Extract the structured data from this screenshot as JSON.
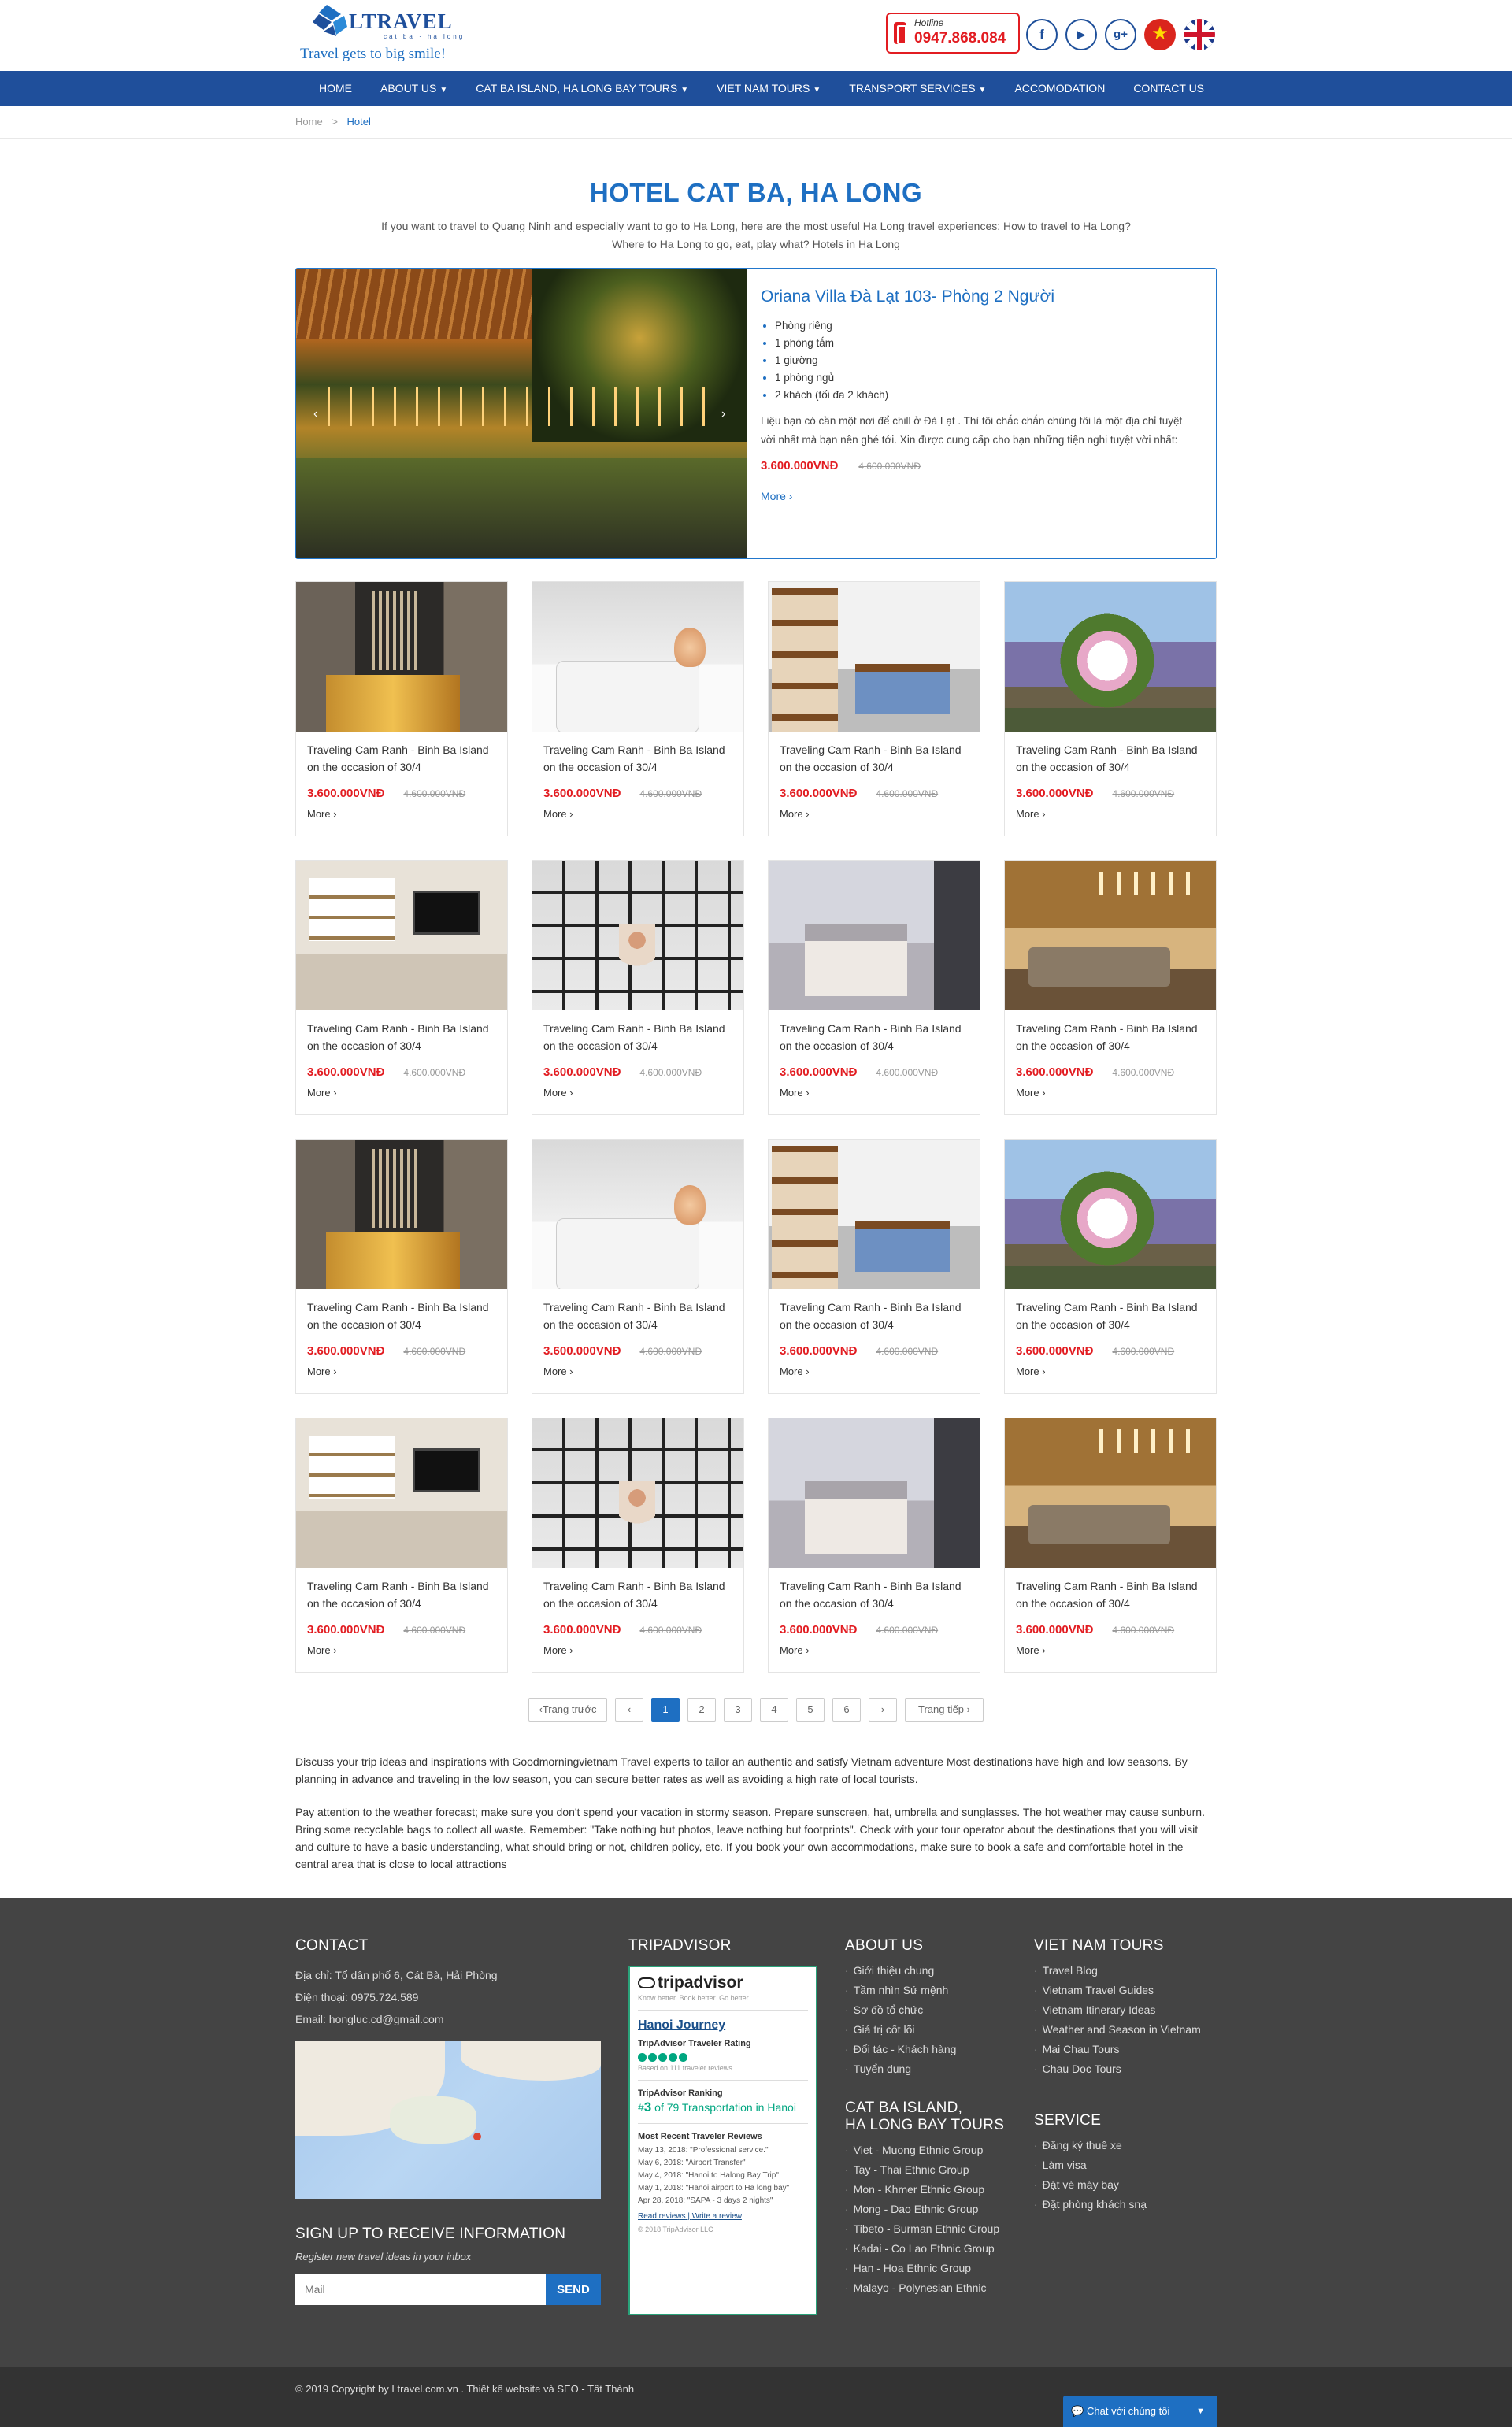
{
  "header": {
    "logo_name": "LTRAVEL",
    "logo_sub": "cat ba · ha long",
    "slogan": "Travel gets to big smile!",
    "hotline_label": "Hotline",
    "hotline_number": "0947.868.084",
    "social": {
      "facebook": "f",
      "youtube": "▶",
      "google": "g+"
    },
    "languages": [
      "vi",
      "en"
    ]
  },
  "nav": {
    "items": [
      {
        "label": "HOME",
        "dropdown": false
      },
      {
        "label": "ABOUT US",
        "dropdown": true
      },
      {
        "label": "CAT BA ISLAND, HA LONG BAY TOURS",
        "dropdown": true
      },
      {
        "label": "VIET NAM TOURS",
        "dropdown": true
      },
      {
        "label": "TRANSPORT SERVICES",
        "dropdown": true
      },
      {
        "label": "ACCOMODATION",
        "dropdown": false
      },
      {
        "label": "CONTACT US",
        "dropdown": false
      }
    ]
  },
  "breadcrumb": {
    "home": "Home",
    "sep": ">",
    "current": "Hotel"
  },
  "page": {
    "title": "HOTEL CAT BA, HA LONG",
    "intro": "If you want to travel to Quang Ninh and especially want to go to Ha Long, here are the most useful Ha Long travel experiences: How to travel to Ha Long? Where to Ha Long to go, eat, play what? Hotels in Ha Long"
  },
  "featured": {
    "title": "Oriana Villa Đà Lạt 103- Phòng 2 Người",
    "features": [
      "Phòng riêng",
      "1 phòng tắm",
      "1 giường",
      "1 phòng ngủ",
      "2 khách (tối đa 2 khách)"
    ],
    "description": "Liệu bạn có cần một nơi để chill ở Đà Lạt . Thì tôi chắc chắn chúng tôi là một địa chỉ tuyệt vời nhất mà bạn nên ghé tới. Xin được cung cấp cho bạn những tiện nghi tuyệt vời nhất:",
    "price": "3.600.000VNĐ",
    "old_price": "4.600.000VNĐ",
    "more": "More"
  },
  "cards": [
    {
      "title": "Traveling Cam Ranh - Binh Ba Island on the occasion of 30/4",
      "price": "3.600.000VNĐ",
      "old_price": "4.600.000VNĐ",
      "more": "More"
    },
    {
      "title": "Traveling Cam Ranh - Binh Ba Island on the occasion of 30/4",
      "price": "3.600.000VNĐ",
      "old_price": "4.600.000VNĐ",
      "more": "More"
    },
    {
      "title": "Traveling Cam Ranh - Binh Ba Island on the occasion of 30/4",
      "price": "3.600.000VNĐ",
      "old_price": "4.600.000VNĐ",
      "more": "More"
    },
    {
      "title": "Traveling Cam Ranh - Binh Ba Island on the occasion of 30/4",
      "price": "3.600.000VNĐ",
      "old_price": "4.600.000VNĐ",
      "more": "More"
    },
    {
      "title": "Traveling Cam Ranh - Binh Ba Island on the occasion of 30/4",
      "price": "3.600.000VNĐ",
      "old_price": "4.600.000VNĐ",
      "more": "More"
    },
    {
      "title": "Traveling Cam Ranh - Binh Ba Island on the occasion of 30/4",
      "price": "3.600.000VNĐ",
      "old_price": "4.600.000VNĐ",
      "more": "More"
    },
    {
      "title": "Traveling Cam Ranh - Binh Ba Island on the occasion of 30/4",
      "price": "3.600.000VNĐ",
      "old_price": "4.600.000VNĐ",
      "more": "More"
    },
    {
      "title": "Traveling Cam Ranh - Binh Ba Island on the occasion of 30/4",
      "price": "3.600.000VNĐ",
      "old_price": "4.600.000VNĐ",
      "more": "More"
    },
    {
      "title": "Traveling Cam Ranh - Binh Ba Island on the occasion of 30/4",
      "price": "3.600.000VNĐ",
      "old_price": "4.600.000VNĐ",
      "more": "More"
    },
    {
      "title": "Traveling Cam Ranh - Binh Ba Island on the occasion of 30/4",
      "price": "3.600.000VNĐ",
      "old_price": "4.600.000VNĐ",
      "more": "More"
    },
    {
      "title": "Traveling Cam Ranh - Binh Ba Island on the occasion of 30/4",
      "price": "3.600.000VNĐ",
      "old_price": "4.600.000VNĐ",
      "more": "More"
    },
    {
      "title": "Traveling Cam Ranh - Binh Ba Island on the occasion of 30/4",
      "price": "3.600.000VNĐ",
      "old_price": "4.600.000VNĐ",
      "more": "More"
    },
    {
      "title": "Traveling Cam Ranh - Binh Ba Island on the occasion of 30/4",
      "price": "3.600.000VNĐ",
      "old_price": "4.600.000VNĐ",
      "more": "More"
    },
    {
      "title": "Traveling Cam Ranh - Binh Ba Island on the occasion of 30/4",
      "price": "3.600.000VNĐ",
      "old_price": "4.600.000VNĐ",
      "more": "More"
    },
    {
      "title": "Traveling Cam Ranh - Binh Ba Island on the occasion of 30/4",
      "price": "3.600.000VNĐ",
      "old_price": "4.600.000VNĐ",
      "more": "More"
    },
    {
      "title": "Traveling Cam Ranh - Binh Ba Island on the occasion of 30/4",
      "price": "3.600.000VNĐ",
      "old_price": "4.600.000VNĐ",
      "more": "More"
    }
  ],
  "pagination": {
    "prev": "Trang trước",
    "next": "Trang tiếp",
    "prev_arrow": "‹",
    "next_arrow": "›",
    "pages": [
      "1",
      "2",
      "3",
      "4",
      "5",
      "6"
    ],
    "current": "1"
  },
  "info": {
    "p1": "Discuss your trip ideas and inspirations with Goodmorningvietnam Travel experts to tailor an authentic and satisfy Vietnam adventure Most destinations have high and low seasons. By planning in advance and traveling in the low season, you can secure better rates as well as avoiding a high rate of local tourists.",
    "p2": "Pay attention to the weather forecast; make sure you don't spend your vacation in stormy season. Prepare sunscreen, hat, umbrella and sunglasses. The hot weather may cause sunburn. Bring some recyclable bags to collect all waste. Remember: \"Take nothing but photos, leave nothing but footprints\". Check with your tour operator about the destinations that you will visit and culture to have a basic understanding, what should bring or not, children policy, etc. If you book your own accommodations, make sure to book a safe and comfortable hotel in the central area that is close to local attractions"
  },
  "footer": {
    "contact": {
      "heading": "CONTACT",
      "address": "Địa chỉ: Tổ dân phố 6, Cát Bà, Hải Phòng",
      "phone": "Điện thoại: 0975.724.589",
      "email": "Email: hongluc.cd@gmail.com"
    },
    "signup": {
      "heading": "SIGN UP TO RECEIVE INFORMATION",
      "text": "Register new travel ideas in your inbox",
      "placeholder": "Mail",
      "button": "SEND"
    },
    "tripadvisor": {
      "heading": "TRIPADVISOR",
      "logo": "tripadvisor",
      "tagline": "Know better. Book better. Go better.",
      "business": "Hanoi Journey",
      "rating_label": "TripAdvisor Traveler Rating",
      "reviews_count": "Based on 111 traveler reviews",
      "ranking_label": "TripAdvisor Ranking",
      "ranking_num": "3",
      "ranking_text": "of 79 Transportation in Hanoi",
      "recent_label": "Most Recent Traveler Reviews",
      "reviews": [
        "May 13, 2018: \"Professional service.\"",
        "May 6, 2018: \"Airport Transfer\"",
        "May 4, 2018: \"Hanoi to Halong Bay Trip\"",
        "May 1, 2018: \"Hanoi airport to Ha long bay\"",
        "Apr 28, 2018: \"SAPA - 3 days 2 nights\""
      ],
      "read_reviews": "Read reviews",
      "write_review": "Write a review",
      "copyright": "© 2018 TripAdvisor LLC"
    },
    "about": {
      "heading": "ABOUT US",
      "items": [
        "Giới thiệu chung",
        "Tầm nhìn Sứ mệnh",
        "Sơ đồ tổ chức",
        "Giá trị cốt lõi",
        "Đối tác - Khách hàng",
        "Tuyển dụng"
      ]
    },
    "catba": {
      "heading_line1": "CAT BA ISLAND,",
      "heading_line2": "HA LONG BAY TOURS",
      "items": [
        "Viet - Muong Ethnic Group",
        "Tay - Thai Ethnic Group",
        "Mon - Khmer Ethnic Group",
        "Mong - Dao Ethnic Group",
        "Tibeto - Burman Ethnic Group",
        "Kadai - Co Lao Ethnic Group",
        "Han - Hoa Ethnic Group",
        "Malayo - Polynesian Ethnic"
      ]
    },
    "vntours": {
      "heading": "VIET NAM TOURS",
      "items": [
        "Travel Blog",
        "Vietnam Travel Guides",
        "Vietnam Itinerary Ideas",
        "Weather and Season in Vietnam",
        "Mai Chau Tours",
        "Chau Doc Tours"
      ]
    },
    "service": {
      "heading": "SERVICE",
      "items": [
        "Đăng ký thuê xe",
        "Làm visa",
        "Đặt vé máy bay",
        "Đặt phòng khách snạ"
      ]
    },
    "copyright": "© 2019 Copyright by Ltravel.com.vn . Thiết kế website và SEO - Tất Thành",
    "chat": "Chat với chúng tôi"
  },
  "colors": {
    "primary": "#1f4f9b",
    "accent": "#1e6fc2",
    "price": "#e21c21",
    "footer": "#444444"
  }
}
